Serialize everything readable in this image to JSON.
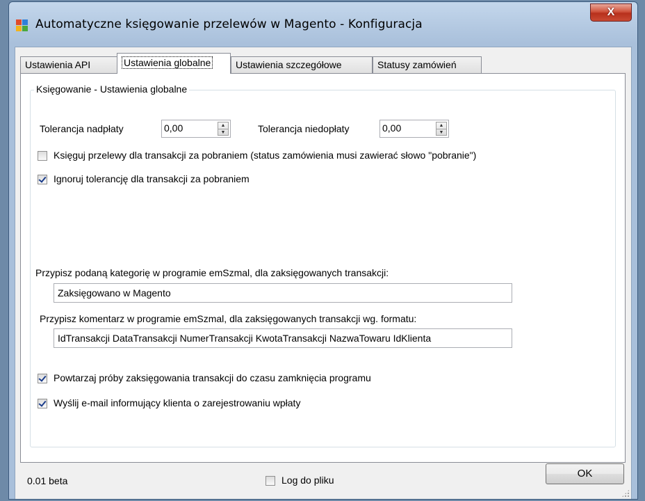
{
  "window": {
    "title": "Automatyczne księgowanie przelewów w Magento - Konfiguracja",
    "close_glyph": "X",
    "icon": "app-windows-icon"
  },
  "tabs": [
    {
      "label": "Ustawienia API",
      "active": false
    },
    {
      "label": "Ustawienia globalne",
      "active": true
    },
    {
      "label": "Ustawienia szczegółowe",
      "active": false
    },
    {
      "label": "Statusy zamówień",
      "active": false
    }
  ],
  "group": {
    "title": "Księgowanie - Ustawienia globalne",
    "overpay_label": "Tolerancja nadpłaty",
    "overpay_value": "0,00",
    "underpay_label": "Tolerancja niedopłaty",
    "underpay_value": "0,00",
    "checkbox_cod": {
      "label": "Księguj przelewy dla transakcji za pobraniem (status zamówienia musi zawierać słowo \"pobranie\")",
      "checked": false
    },
    "checkbox_ignore": {
      "label": "Ignoruj tolerancję dla transakcji za pobraniem",
      "checked": true
    },
    "category_label": "Przypisz podaną kategorię w programie emSzmal, dla zaksięgowanych transakcji:",
    "category_value": "Zaksięgowano w Magento",
    "comment_label": "Przypisz komentarz w programie emSzmal, dla zaksięgowanych transakcji wg. formatu:",
    "comment_value": "IdTransakcji DataTransakcji NumerTransakcji KwotaTransakcji NazwaTowaru IdKlienta",
    "checkbox_retry": {
      "label": "Powtarzaj próby zaksięgowania transakcji do czasu zamknięcia programu",
      "checked": true
    },
    "checkbox_email": {
      "label": "Wyślij e-mail informujący klienta o zarejestrowaniu wpłaty",
      "checked": true
    }
  },
  "footer": {
    "version": "0.01 beta",
    "log_label": "Log do pliku",
    "log_checked": false,
    "ok_label": "OK"
  },
  "colors": {
    "titlebar": "#b6cbe3",
    "close": "#c94a33",
    "checkmark": "#1a3c8a"
  }
}
